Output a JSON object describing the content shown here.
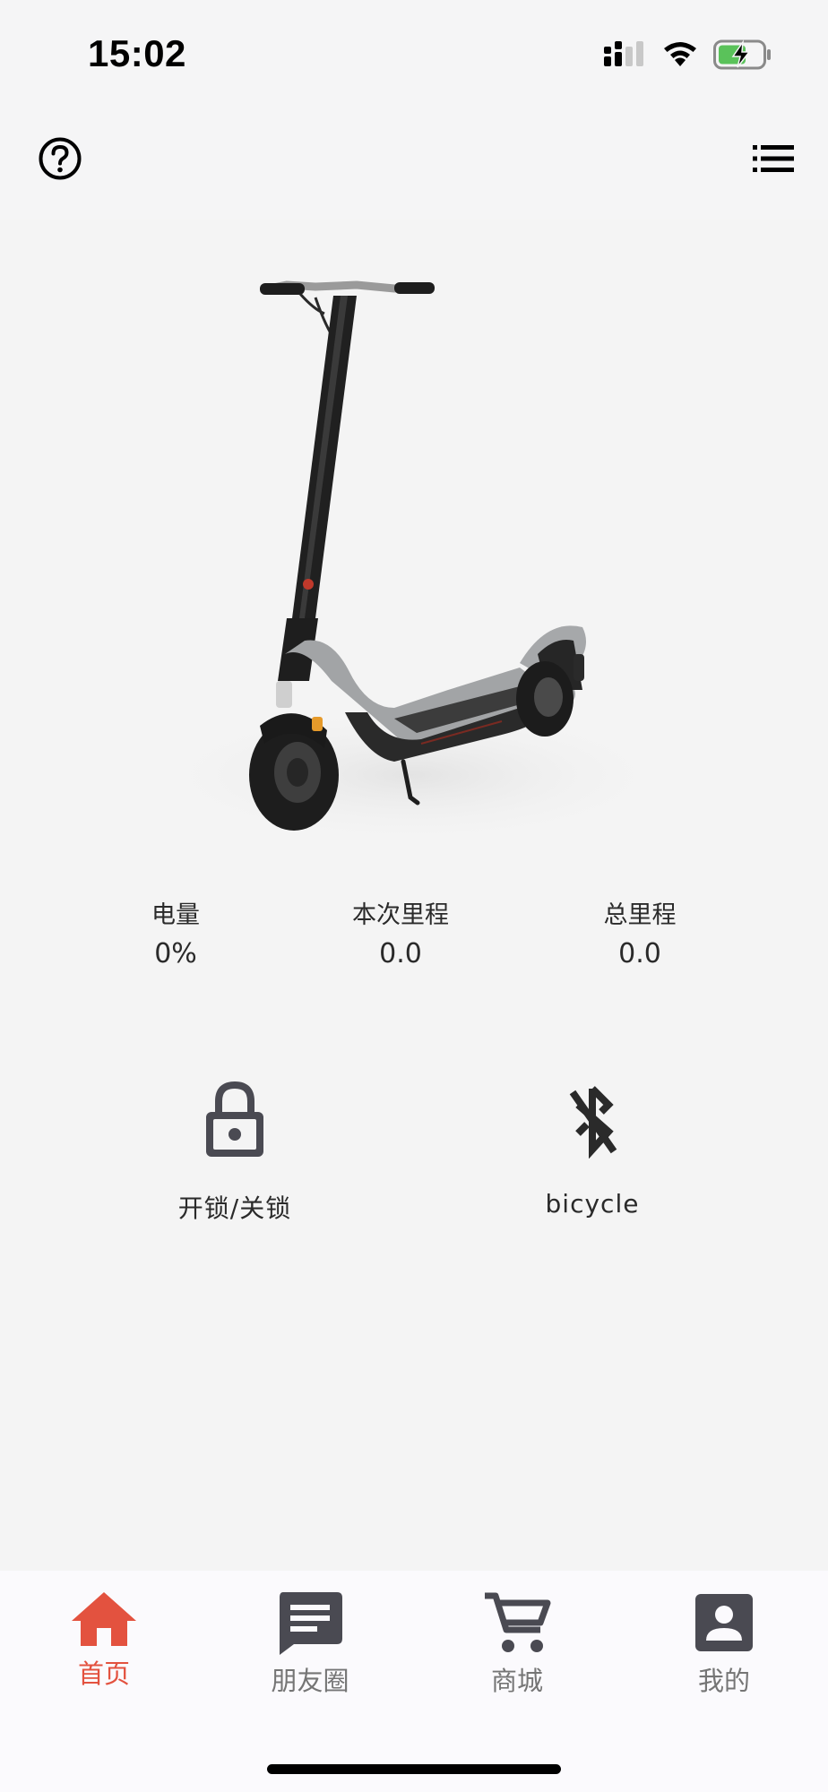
{
  "status_bar": {
    "time": "15:02",
    "icons": [
      "signal-icon",
      "wifi-icon",
      "battery-charging-icon"
    ]
  },
  "top_bar": {
    "left_icon": "help-circle-icon",
    "right_icon": "list-menu-icon"
  },
  "stats": [
    {
      "label": "电量",
      "value": "0%"
    },
    {
      "label": "本次里程",
      "value": "0.0"
    },
    {
      "label": "总里程",
      "value": "0.0"
    }
  ],
  "actions": [
    {
      "label": "开锁/关锁",
      "icon": "lock-icon"
    },
    {
      "label": "bicycle",
      "icon": "bluetooth-disabled-icon"
    }
  ],
  "tabs": [
    {
      "label": "首页",
      "icon": "home-icon",
      "active": true
    },
    {
      "label": "朋友圈",
      "icon": "chat-icon",
      "active": false
    },
    {
      "label": "商城",
      "icon": "cart-icon",
      "active": false
    },
    {
      "label": "我的",
      "icon": "profile-icon",
      "active": false
    }
  ],
  "colors": {
    "accent": "#e3523f",
    "tab_inactive": "#757575",
    "icon_dark": "#4a4a52",
    "background": "#f4f4f4",
    "battery_fill": "#5ac25a"
  }
}
